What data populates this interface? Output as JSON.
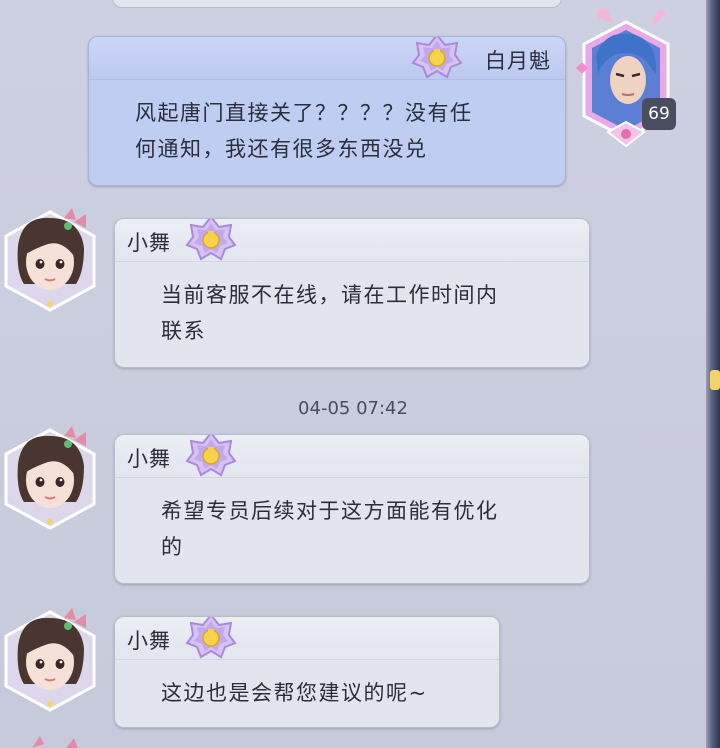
{
  "timestamp": "04-05 07:42",
  "level": "69",
  "messages": [
    {
      "sender": "白月魁",
      "lines": [
        "风起唐门直接关了？？？？没有任",
        "何通知，我还有很多东西没兑"
      ]
    },
    {
      "sender": "小舞",
      "lines": [
        "当前客服不在线，请在工作时间内",
        "联系"
      ]
    },
    {
      "sender": "小舞",
      "lines": [
        "希望专员后续对于这方面能有优化",
        "的"
      ]
    },
    {
      "sender": "小舞",
      "lines": [
        "这边也是会帮您建议的呢~"
      ]
    }
  ],
  "colors": {
    "mine_bubble": "#bfcdf3",
    "other_bubble": "#e2e4ee",
    "badge_purple": "#b48be6",
    "badge_gold": "#f5d34a"
  }
}
